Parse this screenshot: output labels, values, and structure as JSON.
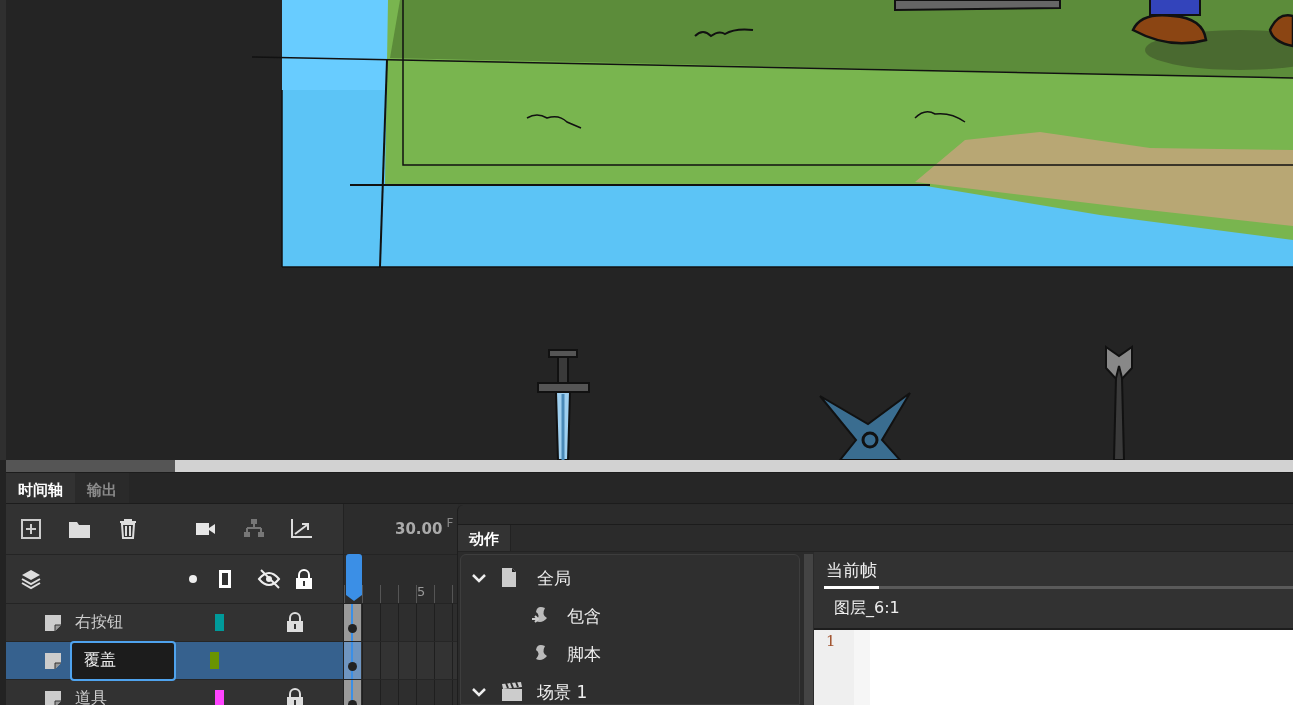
{
  "panel_tabs": [
    {
      "label": "时间轴",
      "selected": true
    },
    {
      "label": "输出",
      "selected": false
    }
  ],
  "timeline": {
    "fps": "30.00",
    "fps_unit": "F",
    "ruler_label": "5",
    "layers": [
      {
        "name": "右按钮",
        "color": "#009a9a",
        "locked": true,
        "selected": false,
        "editing": false
      },
      {
        "name": "覆盖",
        "color": "#6a9400",
        "locked": false,
        "selected": true,
        "editing": true
      },
      {
        "name": "道具",
        "color": "#ff44ff",
        "locked": true,
        "selected": false,
        "editing": false
      }
    ]
  },
  "actions": {
    "title": "动作",
    "tree": [
      {
        "label": "全局",
        "kind": "page",
        "expanded": true,
        "children": [
          {
            "label": "包含",
            "kind": "include"
          },
          {
            "label": "脚本",
            "kind": "script"
          }
        ]
      },
      {
        "label": "场景 1",
        "kind": "scene",
        "expanded": true
      }
    ],
    "script_tabs": [
      {
        "label": "当前帧",
        "selected": true
      }
    ],
    "script_target": "图层_6:1",
    "line_numbers": [
      "1"
    ]
  }
}
